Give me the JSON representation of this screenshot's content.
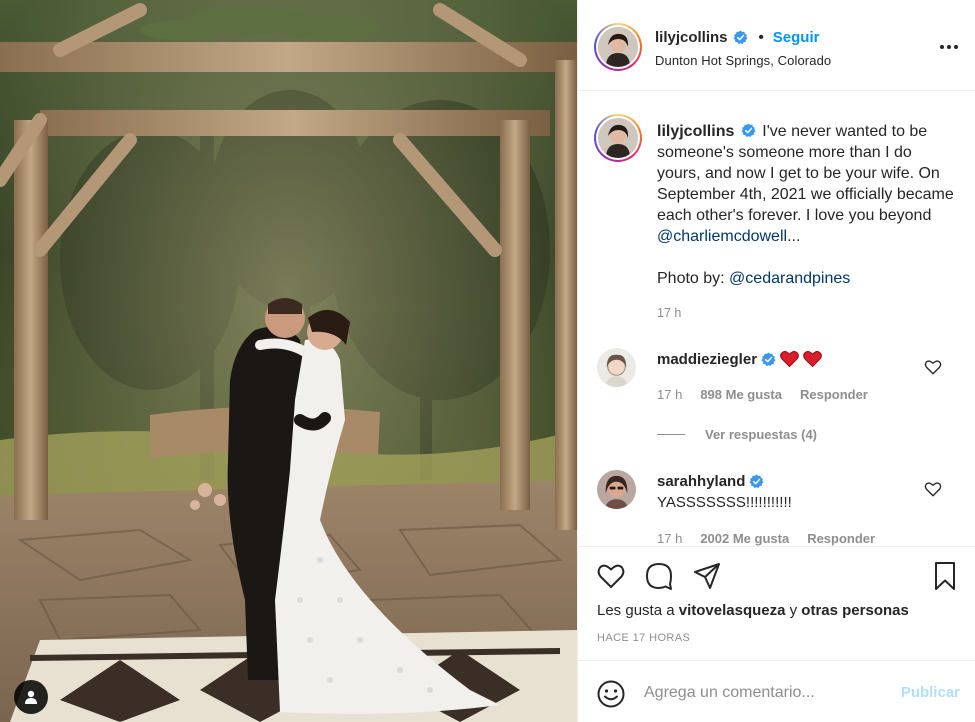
{
  "photo": {
    "user_tag_icon": "user-tag-icon"
  },
  "header": {
    "username": "lilyjcollins",
    "separator": "•",
    "follow_label": "Seguir",
    "location": "Dunton Hot Springs, Colorado",
    "more_icon": "more-options-icon",
    "verified_icon": "verified-badge-icon"
  },
  "caption": {
    "username": "lilyjcollins",
    "text": "I've never wanted to be someone's someone more than I do yours, and now I get to be your wife. On September 4th, 2021 we officially became each other's forever. I love you beyond ",
    "mention_1": "@charliemcdowell",
    "ellipsis": "...",
    "photo_by_label": "Photo by: ",
    "mention_2": "@cedarandpines",
    "time": "17 h"
  },
  "comments": [
    {
      "username": "maddieziegler",
      "text_emoji": "heart-emoji x2",
      "time": "17 h",
      "likes": "898 Me gusta",
      "reply": "Responder",
      "view_replies": "Ver respuestas (4)"
    },
    {
      "username": "sarahhyland",
      "text": "YASSSSSSS!!!!!!!!!!!",
      "time": "17 h",
      "likes": "2002 Me gusta",
      "reply": "Responder"
    }
  ],
  "actions": {
    "like_icon": "heart-icon",
    "comment_icon": "comment-icon",
    "share_icon": "paper-plane-icon",
    "save_icon": "bookmark-icon"
  },
  "likes": {
    "prefix": "Les gusta a ",
    "user": "vitovelasqueza",
    "conjunction": " y ",
    "others": "otras personas"
  },
  "posted_ago": "HACE 17 HORAS",
  "comment_box": {
    "placeholder": "Agrega un comentario...",
    "publish_label": "Publicar",
    "emoji_icon": "smiley-icon"
  },
  "colors": {
    "link_blue": "#0095f6",
    "mention_blue": "#00376b",
    "muted": "#8e8e8e",
    "publish_disabled": "#b2dffc",
    "heart_red": "#ed4956"
  }
}
